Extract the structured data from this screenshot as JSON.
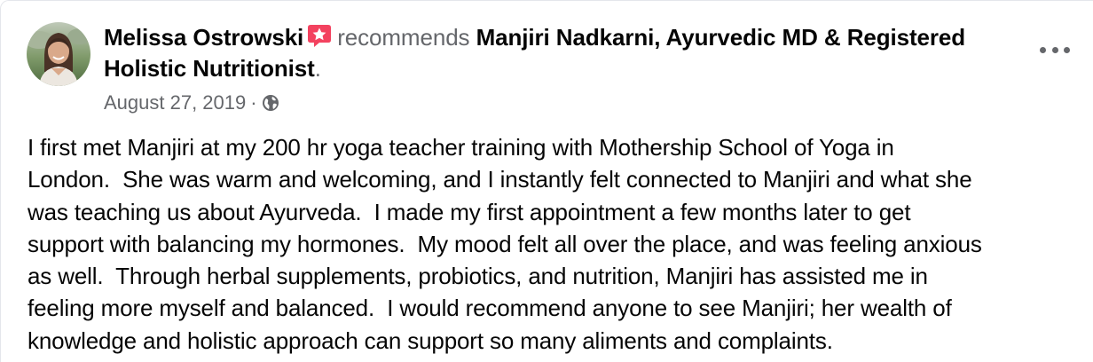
{
  "post": {
    "author": "Melissa Ostrowski",
    "action": "recommends",
    "page_name": "Manjiri Nadkarni, Ayurvedic MD & Registered Holistic Nutritionist",
    "trailing_period": ".",
    "date": "August 27, 2019",
    "separator": "·",
    "audience_icon": "globe-icon",
    "recommendation_icon": "recommend-star-icon",
    "more_icon": "more-options-icon",
    "body": "I first met Manjiri at my 200 hr yoga teacher training with Mothership School of Yoga in\nLondon.  She was warm and welcoming, and I instantly felt connected to Manjiri and what she\nwas teaching us about Ayurveda.  I made my first appointment a few months later to get\nsupport with balancing my hormones.  My mood felt all over the place, and was feeling anxious\nas well.  Through herbal supplements, probiotics, and nutrition, Manjiri has assisted me in\nfeeling more myself and balanced.  I would recommend anyone to see Manjiri; her wealth of\nknowledge and holistic approach can support so many aliments and complaints."
  },
  "colors": {
    "primary_text": "#050505",
    "secondary_text": "#65676b",
    "recommend_badge": "#f3425f",
    "border": "#e4e6eb",
    "background": "#ffffff"
  }
}
